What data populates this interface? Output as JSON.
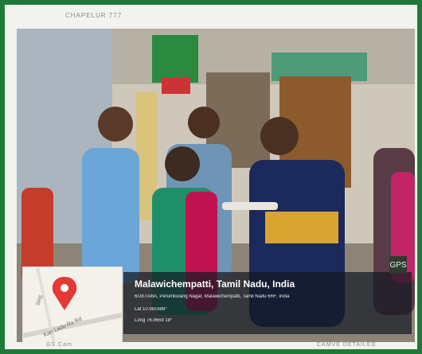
{
  "header": {
    "left_text": "CHAPELUR 777",
    "right_text": ""
  },
  "footer": {
    "left_text": "GS Cam",
    "right_text": "CAMVE DETAILED"
  },
  "overlay": {
    "place_title": "Malawichempatti, Tamil Nadu, India",
    "address_line": "6/287/A6A, Perumkulang Nagar, Malawichempatti, Tamil Nadu 6RF, India",
    "lat_line": "Lat 10.991688°",
    "long_line": "Long 76.9659 18°"
  },
  "map": {
    "road_label": "Kari Ladu Ra Rd",
    "side_label": "SRE"
  },
  "badge": {
    "label": "GPS"
  }
}
